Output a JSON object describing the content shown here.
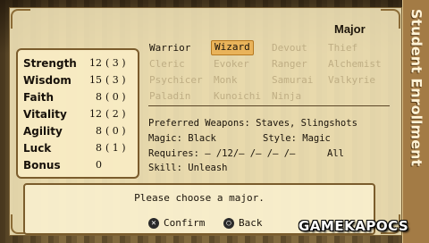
{
  "window": {
    "title": "Student Enrollment"
  },
  "major_title": "Major",
  "stats": [
    {
      "name": "Strength",
      "value": "12",
      "bonus": "( 3 )"
    },
    {
      "name": "Wisdom",
      "value": "15",
      "bonus": "( 3 )"
    },
    {
      "name": "Faith",
      "value": "8",
      "bonus": "( 0 )"
    },
    {
      "name": "Vitality",
      "value": "12",
      "bonus": "( 2 )"
    },
    {
      "name": "Agility",
      "value": "8",
      "bonus": "( 0 )"
    },
    {
      "name": "Luck",
      "value": "8",
      "bonus": "( 1 )"
    },
    {
      "name": "Bonus",
      "value": "0",
      "bonus": ""
    }
  ],
  "majors": [
    {
      "label": "Warrior",
      "state": "active"
    },
    {
      "label": "Wizard",
      "state": "selected"
    },
    {
      "label": "Devout",
      "state": "disabled"
    },
    {
      "label": "Thief",
      "state": "disabled"
    },
    {
      "label": "Cleric",
      "state": "disabled"
    },
    {
      "label": "Evoker",
      "state": "disabled"
    },
    {
      "label": "Ranger",
      "state": "disabled"
    },
    {
      "label": "Alchemist",
      "state": "disabled"
    },
    {
      "label": "Psychicer",
      "state": "disabled"
    },
    {
      "label": "Monk",
      "state": "disabled"
    },
    {
      "label": "Samurai",
      "state": "disabled"
    },
    {
      "label": "Valkyrie",
      "state": "disabled"
    },
    {
      "label": "Paladin",
      "state": "disabled"
    },
    {
      "label": "Kunoichi",
      "state": "disabled"
    },
    {
      "label": "Ninja",
      "state": "disabled"
    }
  ],
  "details": {
    "weapons": "Preferred Weapons: Staves, Slingshots",
    "magic": "Magic: Black",
    "style": "Style: Magic",
    "requires": "Requires: – /12/– /– /– /–",
    "alignment": "All",
    "skill": "Skill: Unleash"
  },
  "message": "Please choose a major.",
  "buttons": {
    "confirm": {
      "icon": "cross-button-icon",
      "symbol": "✕",
      "label": "Confirm"
    },
    "back": {
      "icon": "circle-button-icon",
      "symbol": "○",
      "label": "Back"
    }
  },
  "watermark": "GAMEKAPOCS"
}
